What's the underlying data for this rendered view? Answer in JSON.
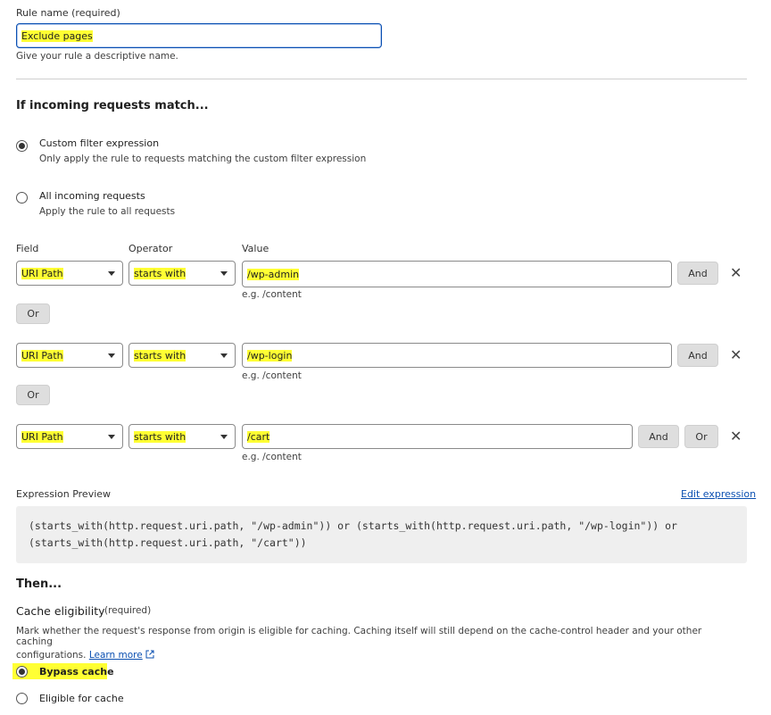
{
  "rule_name": {
    "label": "Rule name (required)",
    "value": "Exclude pages",
    "help": "Give your rule a descriptive name."
  },
  "match": {
    "heading": "If incoming requests match...",
    "options": [
      {
        "title": "Custom filter expression",
        "desc": "Only apply the rule to requests matching the custom filter expression",
        "checked": true
      },
      {
        "title": "All incoming requests",
        "desc": "Apply the rule to all requests",
        "checked": false
      }
    ]
  },
  "builder": {
    "headers": {
      "field": "Field",
      "operator": "Operator",
      "value": "Value"
    },
    "rows": [
      {
        "field": "URI Path",
        "operator": "starts with",
        "value": "/wp-admin",
        "example": "e.g. /content",
        "and_label": "And"
      },
      {
        "field": "URI Path",
        "operator": "starts with",
        "value": "/wp-login",
        "example": "e.g. /content",
        "and_label": "And"
      },
      {
        "field": "URI Path",
        "operator": "starts with",
        "value": "/cart",
        "example": "e.g. /content",
        "and_label": "And",
        "or_label": "Or"
      }
    ],
    "or_separators": [
      "Or",
      "Or"
    ]
  },
  "expression": {
    "label": "Expression Preview",
    "edit_link": "Edit expression",
    "line1": "(starts_with(http.request.uri.path, \"/wp-admin\")) or (starts_with(http.request.uri.path, \"/wp-login\")) or",
    "line2": "(starts_with(http.request.uri.path, \"/cart\"))"
  },
  "then": {
    "heading": "Then...",
    "cache_label": "Cache eligibility",
    "required": "(required)",
    "desc_line1": "Mark whether the request's response from origin is eligible for caching. Caching itself will still depend on the cache-control header and your other caching",
    "desc_line2": "configurations.",
    "learn_more": "Learn more",
    "options": [
      {
        "label": "Bypass cache",
        "checked": true
      },
      {
        "label": "Eligible for cache",
        "checked": false
      }
    ]
  },
  "colors": {
    "highlight": "#ffff33",
    "link": "#0a4fb1",
    "code_bg": "#efefef"
  }
}
